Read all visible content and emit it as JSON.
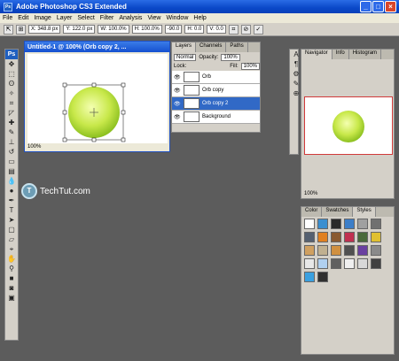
{
  "window": {
    "title": "Adobe Photoshop CS3 Extended",
    "app_icon": "Ps"
  },
  "menu": [
    "File",
    "Edit",
    "Image",
    "Layer",
    "Select",
    "Filter",
    "Analysis",
    "View",
    "Window",
    "Help"
  ],
  "options": {
    "x": "X: 348.8 px",
    "y": "Y: 122.0 px",
    "w": "W: 100.0%",
    "h": "H: 100.0%",
    "angle": "-90.0",
    "hskew": "H: 0.0",
    "vskew": "V: 0.0"
  },
  "document": {
    "title": "Untitled-1 @ 100% (Orb copy 2, ...",
    "zoom": "100%"
  },
  "layers": {
    "tabs": [
      "Layers",
      "Channels",
      "Paths"
    ],
    "blend_mode": "Normal",
    "opacity_label": "Opacity:",
    "opacity": "100%",
    "lock_label": "Lock:",
    "fill_label": "Fill:",
    "fill": "100%",
    "items": [
      {
        "name": "Orb"
      },
      {
        "name": "Orb copy"
      },
      {
        "name": "Orb copy 2"
      },
      {
        "name": "Background"
      }
    ]
  },
  "navigator": {
    "tabs": [
      "Navigator",
      "Info",
      "Histogram"
    ],
    "zoom": "100%"
  },
  "styles": {
    "tabs": [
      "Color",
      "Swatches",
      "Styles"
    ]
  },
  "watermark": {
    "brand": "TechTut.com",
    "logo": "T"
  },
  "colors": {
    "orb": "#c8e84a",
    "titlebar": "#0a48c8"
  }
}
